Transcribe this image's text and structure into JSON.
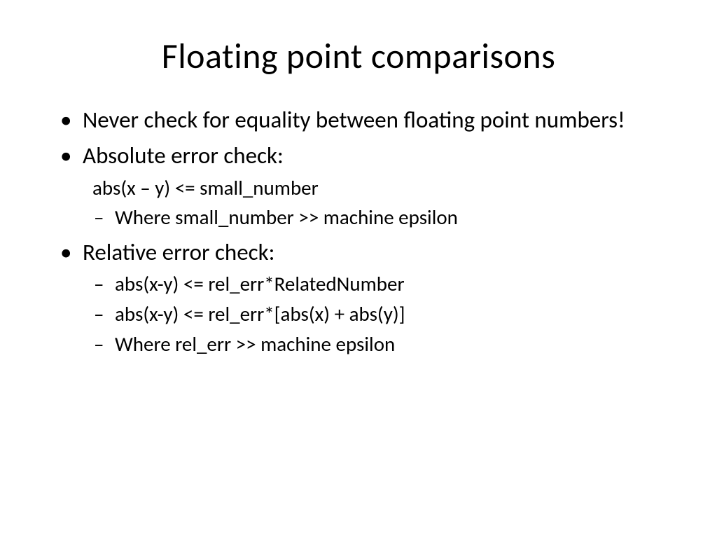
{
  "title": "Floating point comparisons",
  "bullets": {
    "b1": "Never check for equality between floating point numbers!",
    "b2": "Absolute error check:",
    "b2_sub1": "abs(x – y) <= small_number",
    "b2_sub2": "Where small_number >> machine epsilon",
    "b3": "Relative error check:",
    "b3_sub1": "abs(x-y) <= rel_err*RelatedNumber",
    "b3_sub2": "abs(x-y) <= rel_err*[abs(x) + abs(y)]",
    "b3_sub3": "Where rel_err >> machine epsilon"
  }
}
